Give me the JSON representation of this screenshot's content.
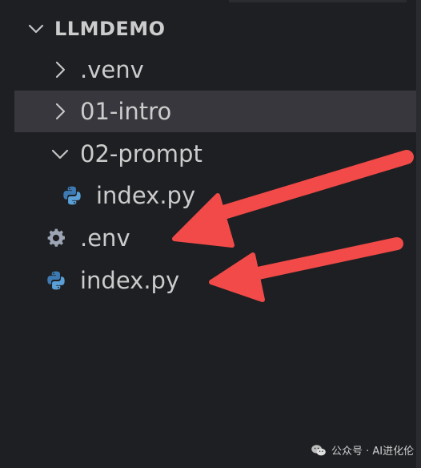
{
  "explorer": {
    "root": {
      "label": "LLMDEMO",
      "expanded": true
    },
    "items": [
      {
        "label": ".venv",
        "type": "folder",
        "expanded": false,
        "depth": 1
      },
      {
        "label": "01-intro",
        "type": "folder",
        "expanded": false,
        "depth": 1,
        "selected": true
      },
      {
        "label": "02-prompt",
        "type": "folder",
        "expanded": true,
        "depth": 1
      },
      {
        "label": "index.py",
        "type": "python-file",
        "depth": 2
      },
      {
        "label": ".env",
        "type": "env-file",
        "depth": 1
      },
      {
        "label": "index.py",
        "type": "python-file",
        "depth": 1
      }
    ]
  },
  "icons": {
    "chevron_expanded": "chevron-down-icon",
    "chevron_collapsed": "chevron-right-icon",
    "python_file": "python-icon",
    "env_file": "gear-icon"
  },
  "colors": {
    "background": "#1e1f22",
    "selected_row": "#37373d",
    "text": "#cccccc",
    "annotation_arrow": "#f24a48",
    "python_blue": "#3d7ab3",
    "python_yellow": "#5a9fd6",
    "gear": "#9da5b4"
  },
  "watermark": {
    "text": "公众号 · AI进化伦"
  }
}
